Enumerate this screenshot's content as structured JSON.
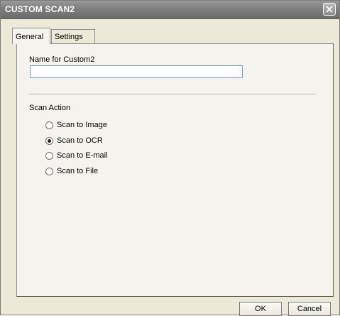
{
  "window": {
    "title": "CUSTOM SCAN2"
  },
  "icons": {
    "close": "close-icon"
  },
  "tabs": [
    {
      "label": "General",
      "active": true
    },
    {
      "label": "Settings",
      "active": false
    }
  ],
  "general": {
    "name_label": "Name for Custom2",
    "name_value": "",
    "scan_action_label": "Scan Action",
    "options": [
      {
        "label": "Scan to Image",
        "selected": false
      },
      {
        "label": "Scan to OCR",
        "selected": true
      },
      {
        "label": "Scan to E-mail",
        "selected": false
      },
      {
        "label": "Scan to File",
        "selected": false
      }
    ]
  },
  "buttons": {
    "ok": "OK",
    "cancel": "Cancel"
  }
}
